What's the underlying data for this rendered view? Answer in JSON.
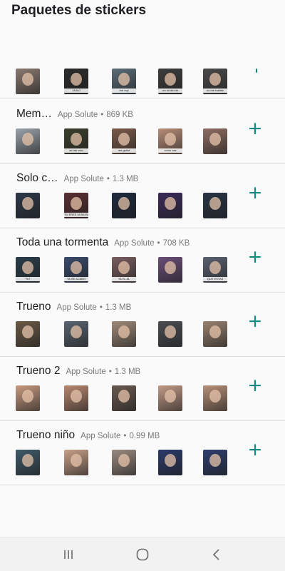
{
  "header": {
    "title": "Paquetes de stickers"
  },
  "colors": {
    "accent": "#0f8a7e",
    "divider": "#dedede",
    "meta": "#7a7a7a"
  },
  "partial_row": {
    "thumbs": [
      {
        "tone": "#8a7a70",
        "caption": ""
      },
      {
        "tone": "#2b2b2b",
        "caption": "JAJAJ"
      },
      {
        "tone": "#5a6d78",
        "caption": "me voy"
      },
      {
        "tone": "#3d3d3d",
        "caption": "en mi da ida"
      },
      {
        "tone": "#4a4a4a",
        "caption": "no me hables"
      }
    ]
  },
  "packs": [
    {
      "name": "Mem…",
      "author": "App Solute",
      "size": "869 KB",
      "add_icon": "plus-icon",
      "thumbs": [
        {
          "tone": "#9aa3ab",
          "caption": ""
        },
        {
          "tone": "#3a3f2c",
          "caption": "se me volo"
        },
        {
          "tone": "#7b5a4a",
          "caption": "me gusta"
        },
        {
          "tone": "#b88d78",
          "caption": "como vas"
        },
        {
          "tone": "#8f6d63",
          "caption": ""
        }
      ]
    },
    {
      "name": "Solo c…",
      "author": "App Solute",
      "size": "1.3 MB",
      "add_icon": "plus-icon",
      "thumbs": [
        {
          "tone": "#2d3848",
          "caption": ""
        },
        {
          "tone": "#5a2f33",
          "caption": "TU ERES MI MUSA"
        },
        {
          "tone": "#1f2a3d",
          "caption": ""
        },
        {
          "tone": "#3b2a5a",
          "caption": ""
        },
        {
          "tone": "#2a3547",
          "caption": ""
        }
      ]
    },
    {
      "name": "Toda una tormenta",
      "author": "App Solute",
      "size": "708 KB",
      "add_icon": "plus-icon",
      "thumbs": [
        {
          "tone": "#2a3d4a",
          "caption": "Yo?"
        },
        {
          "tone": "#3a4a6a",
          "caption": "YA SE ACABO"
        },
        {
          "tone": "#7a5e60",
          "caption": "YA EL AL"
        },
        {
          "tone": "#6a4e78",
          "caption": ""
        },
        {
          "tone": "#5a6270",
          "caption": "QUE ESTAS"
        }
      ]
    },
    {
      "name": "Trueno",
      "author": "App Solute",
      "size": "1.3 MB",
      "add_icon": "plus-icon",
      "thumbs": [
        {
          "tone": "#6b5a45",
          "caption": ""
        },
        {
          "tone": "#5a6470",
          "caption": ""
        },
        {
          "tone": "#a08a78",
          "caption": ""
        },
        {
          "tone": "#4a4e52",
          "caption": ""
        },
        {
          "tone": "#9a8270",
          "caption": ""
        }
      ]
    },
    {
      "name": "Trueno 2",
      "author": "App Solute",
      "size": "1.3 MB",
      "add_icon": "plus-icon",
      "thumbs": [
        {
          "tone": "#c89a80",
          "caption": ""
        },
        {
          "tone": "#b88870",
          "caption": ""
        },
        {
          "tone": "#6a5a50",
          "caption": ""
        },
        {
          "tone": "#c29a86",
          "caption": ""
        },
        {
          "tone": "#b89078",
          "caption": ""
        }
      ]
    },
    {
      "name": "Trueno niño",
      "author": "App Solute",
      "size": "0.99 MB",
      "add_icon": "plus-icon",
      "thumbs": [
        {
          "tone": "#3e5a6a",
          "caption": ""
        },
        {
          "tone": "#c8a088",
          "caption": ""
        },
        {
          "tone": "#9a8a80",
          "caption": ""
        },
        {
          "tone": "#2a3a6a",
          "caption": ""
        },
        {
          "tone": "#2e3e6e",
          "caption": ""
        }
      ]
    }
  ],
  "navigation": {
    "recents_icon": "recents-icon",
    "home_icon": "home-icon",
    "back_icon": "back-icon"
  }
}
